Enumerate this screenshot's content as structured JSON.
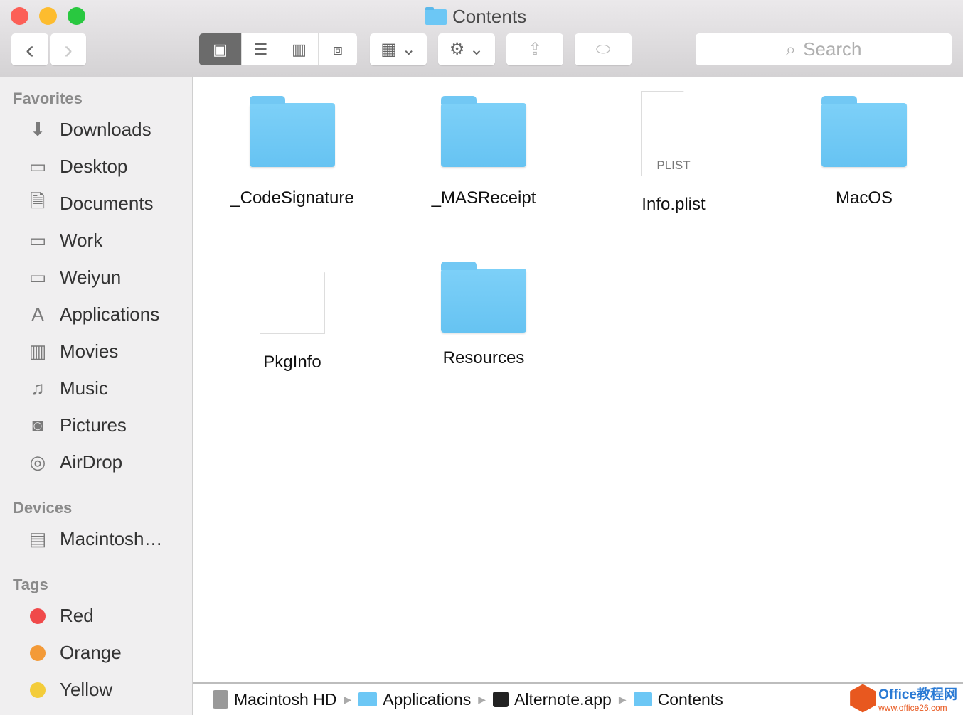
{
  "window": {
    "title": "Contents"
  },
  "toolbar": {
    "back": "‹",
    "forward": "›",
    "search_placeholder": "Search"
  },
  "sidebar": {
    "favorites_header": "Favorites",
    "favorites": [
      {
        "label": "Downloads",
        "icon": "download-icon",
        "glyph": "⬇"
      },
      {
        "label": "Desktop",
        "icon": "desktop-icon",
        "glyph": "▭"
      },
      {
        "label": "Documents",
        "icon": "documents-icon",
        "glyph": "🗎"
      },
      {
        "label": "Work",
        "icon": "folder-icon",
        "glyph": "▭"
      },
      {
        "label": "Weiyun",
        "icon": "folder-icon",
        "glyph": "▭"
      },
      {
        "label": "Applications",
        "icon": "applications-icon",
        "glyph": "A"
      },
      {
        "label": "Movies",
        "icon": "movies-icon",
        "glyph": "▥"
      },
      {
        "label": "Music",
        "icon": "music-icon",
        "glyph": "♫"
      },
      {
        "label": "Pictures",
        "icon": "camera-icon",
        "glyph": "◙"
      },
      {
        "label": "AirDrop",
        "icon": "airdrop-icon",
        "glyph": "◎"
      }
    ],
    "devices_header": "Devices",
    "devices": [
      {
        "label": "Macintosh…",
        "icon": "hard-drive-icon",
        "glyph": "▤"
      }
    ],
    "tags_header": "Tags",
    "tags": [
      {
        "label": "Red",
        "color": "#f0494a"
      },
      {
        "label": "Orange",
        "color": "#f39a38"
      },
      {
        "label": "Yellow",
        "color": "#f3cc3a"
      }
    ]
  },
  "files": [
    {
      "name": "_CodeSignature",
      "type": "folder"
    },
    {
      "name": "_MASReceipt",
      "type": "folder"
    },
    {
      "name": "Info.plist",
      "type": "plist",
      "badge": "PLIST"
    },
    {
      "name": "MacOS",
      "type": "folder"
    },
    {
      "name": "PkgInfo",
      "type": "document"
    },
    {
      "name": "Resources",
      "type": "folder"
    }
  ],
  "pathbar": [
    "Macintosh HD",
    "Applications",
    "Alternote.app",
    "Contents"
  ],
  "watermark": {
    "line1": "Office教程网",
    "line2": "www.office26.com"
  }
}
